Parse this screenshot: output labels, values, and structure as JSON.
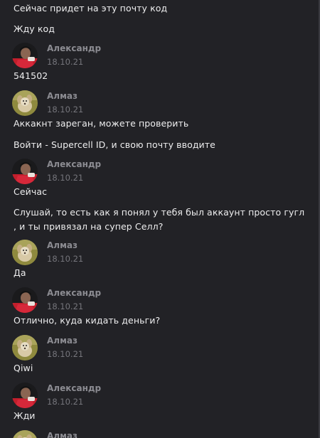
{
  "authors": {
    "alexander": "Александр",
    "almaz": "Алмаз"
  },
  "avatars": {
    "alexander": "avatar-man-in-red-shirt",
    "almaz": "avatar-dog-puppy"
  },
  "colors": {
    "background": "#222226",
    "message_text": "#eeeeef",
    "author_text": "#8c8c92",
    "date_text": "#75757b"
  },
  "messages": [
    {
      "text": "Сейчас придет на эту почту код"
    },
    {
      "text": "Жду код"
    },
    {
      "author": "Александр",
      "date": "18.10.21",
      "text": "541502"
    },
    {
      "author": "Алмаз",
      "date": "18.10.21",
      "text": "Аккакнт зареган, можете проверить"
    },
    {
      "text": "Войти - Supercell ID, и свою почту вводите"
    },
    {
      "author": "Александр",
      "date": "18.10.21",
      "text": "Сейчас"
    },
    {
      "text": "Слушай, то есть как я понял у тебя был аккаунт просто гугл , и ты привязал на супер Селл?"
    },
    {
      "author": "Алмаз",
      "date": "18.10.21",
      "text": "Да"
    },
    {
      "author": "Александр",
      "date": "18.10.21",
      "text": "Отлично, куда кидать деньги?"
    },
    {
      "author": "Алмаз",
      "date": "18.10.21",
      "text": "Qiwi"
    },
    {
      "author": "Александр",
      "date": "18.10.21",
      "text": "Жди"
    },
    {
      "author": "Алмаз"
    }
  ]
}
